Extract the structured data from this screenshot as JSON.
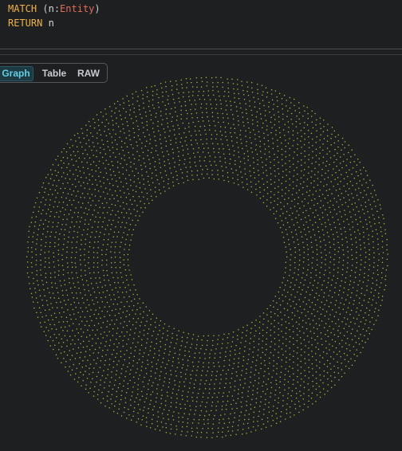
{
  "query": {
    "line1": {
      "keyword": "MATCH",
      "open_paren": " (",
      "variable": "n",
      "colon": ":",
      "label": "Entity",
      "close_paren": ")"
    },
    "line2": {
      "keyword": "RETURN",
      "variable": " n"
    }
  },
  "view_tabs": {
    "graph": "Graph",
    "table": "Table",
    "raw": "RAW",
    "active": "Graph"
  },
  "graph": {
    "node_color": "#9bbd3c",
    "layout": "ring",
    "edges": "none"
  },
  "colors": {
    "background": "#1e1f21",
    "keyword": "#f1b24a",
    "label": "#e26d5a",
    "active_tab_text": "#64cfe4",
    "node": "#9bbd3c"
  }
}
